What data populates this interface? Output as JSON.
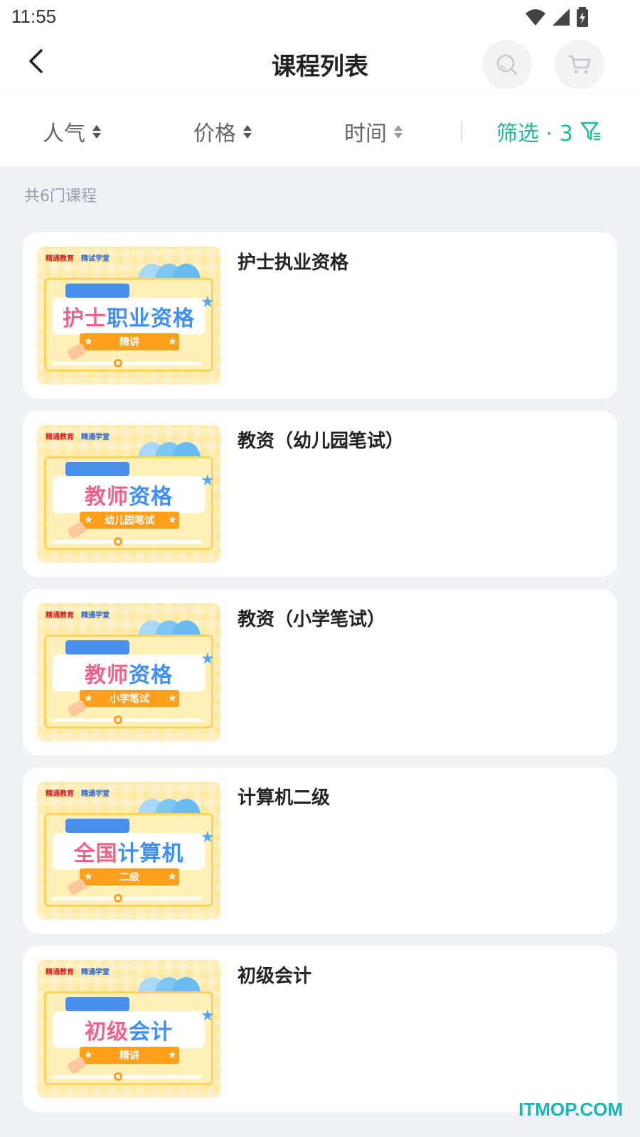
{
  "status_bar": {
    "time": "11:55",
    "icons": [
      "wifi-icon",
      "signal-icon",
      "battery-charging-icon"
    ]
  },
  "nav": {
    "title": "课程列表",
    "icons": [
      "back-chevron-icon",
      "search-icon",
      "cart-icon"
    ]
  },
  "sort_bar": {
    "popularity": "人气",
    "price": "价格",
    "time": "时间",
    "filter_label": "筛选 · 3",
    "accent_color": "#1fb89a"
  },
  "course_count": "共6门课程",
  "courses": [
    {
      "title": "护士执业资格",
      "thumb": {
        "logo_left": "精通教育",
        "logo_right": "精试学堂",
        "headline_pink": "护士",
        "headline_blue": "职业资格",
        "ribbon": "精讲"
      }
    },
    {
      "title": "教资（幼儿园笔试）",
      "thumb": {
        "logo_left": "精通教育",
        "logo_right": "精通学堂",
        "headline_pink": "教师",
        "headline_blue": "资格",
        "ribbon": "幼儿园笔试"
      }
    },
    {
      "title": "教资（小学笔试）",
      "thumb": {
        "logo_left": "精通教育",
        "logo_right": "精通学堂",
        "headline_pink": "教师",
        "headline_blue": "资格",
        "ribbon": "小学笔试"
      }
    },
    {
      "title": "计算机二级",
      "thumb": {
        "logo_left": "精通教育",
        "logo_right": "精通学堂",
        "headline_pink": "全国",
        "headline_blue": "计算机",
        "ribbon": "二级"
      }
    },
    {
      "title": "初级会计",
      "thumb": {
        "logo_left": "精通教育",
        "logo_right": "精通学堂",
        "headline_pink": "初级",
        "headline_blue": "会计",
        "ribbon": "精讲"
      }
    }
  ],
  "watermark": "ITMOP.COM"
}
